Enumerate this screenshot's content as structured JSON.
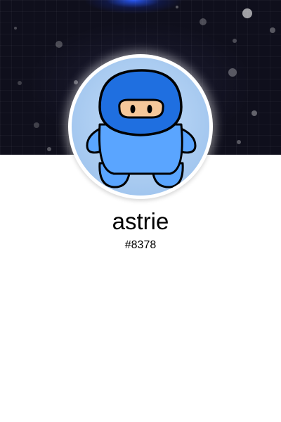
{
  "profile": {
    "username": "astrie",
    "discriminator": "#8378",
    "avatar_icon": "blue-ninja-character-icon"
  },
  "banner": {
    "style": "dark starfield",
    "accent_color": "#1f5fff",
    "background_color": "#0f0f1c"
  },
  "colors": {
    "avatar_body": "#5aa5ff",
    "avatar_hood": "#1f6fe0",
    "avatar_bg": "#b7d3f4",
    "text": "#000000"
  }
}
